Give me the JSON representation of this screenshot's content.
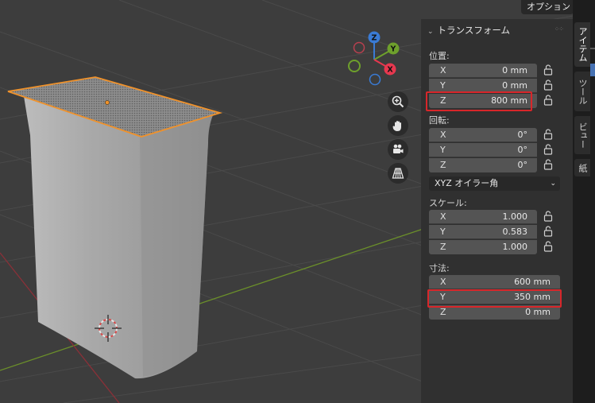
{
  "header": {
    "options_label": "オプション"
  },
  "panel": {
    "title": "トランスフォーム",
    "location": {
      "label": "位置:",
      "rows": [
        {
          "axis": "X",
          "value": "0 mm"
        },
        {
          "axis": "Y",
          "value": "0 mm"
        },
        {
          "axis": "Z",
          "value": "800 mm"
        }
      ]
    },
    "rotation": {
      "label": "回転:",
      "rows": [
        {
          "axis": "X",
          "value": "0°"
        },
        {
          "axis": "Y",
          "value": "0°"
        },
        {
          "axis": "Z",
          "value": "0°"
        }
      ]
    },
    "rotation_mode": "XYZ オイラー角",
    "scale": {
      "label": "スケール:",
      "rows": [
        {
          "axis": "X",
          "value": "1.000"
        },
        {
          "axis": "Y",
          "value": "0.583"
        },
        {
          "axis": "Z",
          "value": "1.000"
        }
      ]
    },
    "dimensions": {
      "label": "寸法:",
      "rows": [
        {
          "axis": "X",
          "value": "600 mm"
        },
        {
          "axis": "Y",
          "value": "350 mm"
        },
        {
          "axis": "Z",
          "value": "0 mm"
        }
      ]
    }
  },
  "gizmo": {
    "z": "Z",
    "y": "Y",
    "x": "X"
  },
  "tabs": [
    "アイテム",
    "ツール",
    "ビュー",
    "紙"
  ],
  "colors": {
    "viewport_bg": "#3d3d3d",
    "selection_outline": "#f0922b",
    "highlight": "#d8262a",
    "axis_x": "#e8384f",
    "axis_y": "#6ea02c",
    "axis_z": "#3a7bd5"
  },
  "icons": [
    "zoom-icon",
    "hand-pan-icon",
    "camera-icon",
    "perspective-grid-icon",
    "lock-icon",
    "chevron-down-icon",
    "cursor-3d-icon"
  ]
}
